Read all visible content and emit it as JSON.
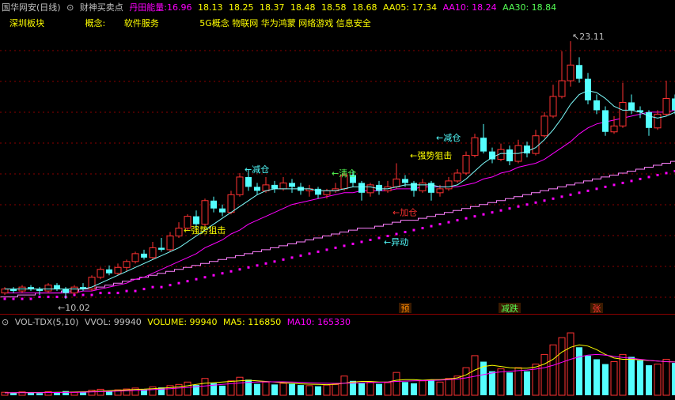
{
  "header": {
    "title": "国华网安(日线)",
    "indicator_name": "财神买卖点",
    "energy_label": "丹田能量:",
    "energy_value": "16.96",
    "levels": [
      "18.13",
      "18.25",
      "18.37",
      "18.48",
      "18.58",
      "18.68"
    ],
    "aa05": "AA05: 17.34",
    "aa10": "AA10: 18.24",
    "aa30": "AA30: 18.84",
    "board": "深圳板块",
    "concept_label": "概念:",
    "concept_1": "软件服务",
    "concept_2": "5G概念 物联网 华为鸿蒙 网络游戏 信息安全"
  },
  "volume_header": {
    "name": "VOL-TDX(5,10)",
    "vvol": "VVOL: 99940",
    "volume": "VOLUME: 99940",
    "ma5": "MA5: 116850",
    "ma10": "MA10: 165330"
  },
  "colors": {
    "up": "#ff3232",
    "down": "#54ffff",
    "ma_white": "#ffffff",
    "ma_magenta": "#ff00ff",
    "ma_yellow": "#ffff00",
    "dots": "#ff00ff",
    "grid": "#8b0000"
  },
  "chart_data": {
    "type": "candlestick",
    "price_range": [
      9.6,
      23.6
    ],
    "high_label": "23.11",
    "low_label": "10.02",
    "candles": [
      [
        10.3,
        10.5,
        10.6,
        10.2
      ],
      [
        10.5,
        10.4,
        10.6,
        10.3
      ],
      [
        10.4,
        10.6,
        10.7,
        10.3
      ],
      [
        10.6,
        10.5,
        10.7,
        10.4
      ],
      [
        10.5,
        10.4,
        10.6,
        10.2
      ],
      [
        10.4,
        10.7,
        10.8,
        10.3
      ],
      [
        10.7,
        10.5,
        10.8,
        10.4
      ],
      [
        10.5,
        10.3,
        10.6,
        10.0
      ],
      [
        10.3,
        10.6,
        10.7,
        10.2
      ],
      [
        10.6,
        10.5,
        10.8,
        10.4
      ],
      [
        10.5,
        11.1,
        11.2,
        10.4
      ],
      [
        11.1,
        11.5,
        11.6,
        11.0
      ],
      [
        11.5,
        11.3,
        11.7,
        11.2
      ],
      [
        11.3,
        11.6,
        11.8,
        11.2
      ],
      [
        11.6,
        11.9,
        12.0,
        11.4
      ],
      [
        11.9,
        12.3,
        12.4,
        11.8
      ],
      [
        12.3,
        12.1,
        12.5,
        12.0
      ],
      [
        12.1,
        12.6,
        12.9,
        12.0
      ],
      [
        12.6,
        12.5,
        13.1,
        12.4
      ],
      [
        12.5,
        13.2,
        13.4,
        12.4
      ],
      [
        13.2,
        13.6,
        13.9,
        13.1
      ],
      [
        13.6,
        14.2,
        14.3,
        13.5
      ],
      [
        14.2,
        13.8,
        14.5,
        13.6
      ],
      [
        13.8,
        15.0,
        15.1,
        13.7
      ],
      [
        15.0,
        14.6,
        15.2,
        14.4
      ],
      [
        14.6,
        14.4,
        14.8,
        14.2
      ],
      [
        14.4,
        15.3,
        15.5,
        14.3
      ],
      [
        15.3,
        16.2,
        16.4,
        15.2
      ],
      [
        16.2,
        15.7,
        16.6,
        15.5
      ],
      [
        15.7,
        15.5,
        15.9,
        15.3
      ],
      [
        15.5,
        15.8,
        16.2,
        15.4
      ],
      [
        15.8,
        15.6,
        16.0,
        15.4
      ],
      [
        15.6,
        15.9,
        16.2,
        15.5
      ],
      [
        15.9,
        15.7,
        16.1,
        15.4
      ],
      [
        15.7,
        15.5,
        15.9,
        15.3
      ],
      [
        15.5,
        15.6,
        15.8,
        15.2
      ],
      [
        15.6,
        15.3,
        15.7,
        15.1
      ],
      [
        15.3,
        15.5,
        15.6,
        15.1
      ],
      [
        15.5,
        15.6,
        15.9,
        15.4
      ],
      [
        15.6,
        16.3,
        16.5,
        15.5
      ],
      [
        16.3,
        15.9,
        16.5,
        15.7
      ],
      [
        15.9,
        15.4,
        16.0,
        15.0
      ],
      [
        15.4,
        15.8,
        15.9,
        15.2
      ],
      [
        15.8,
        15.5,
        16.0,
        15.3
      ],
      [
        15.5,
        15.7,
        16.0,
        15.4
      ],
      [
        15.7,
        16.1,
        16.9,
        15.6
      ],
      [
        16.1,
        15.9,
        16.3,
        15.7
      ],
      [
        15.9,
        15.5,
        16.0,
        15.2
      ],
      [
        15.5,
        15.9,
        16.1,
        15.4
      ],
      [
        15.9,
        15.4,
        16.0,
        15.0
      ],
      [
        15.4,
        15.6,
        15.8,
        15.2
      ],
      [
        15.6,
        16.0,
        16.2,
        15.5
      ],
      [
        16.0,
        16.4,
        16.6,
        15.9
      ],
      [
        16.4,
        17.3,
        17.5,
        16.3
      ],
      [
        17.3,
        18.2,
        18.4,
        17.2
      ],
      [
        18.2,
        17.5,
        18.9,
        17.4
      ],
      [
        17.5,
        17.1,
        17.7,
        16.9
      ],
      [
        17.1,
        17.6,
        17.9,
        17.0
      ],
      [
        17.6,
        17.0,
        17.8,
        16.8
      ],
      [
        17.0,
        17.8,
        18.1,
        16.9
      ],
      [
        17.8,
        17.4,
        18.0,
        17.2
      ],
      [
        17.4,
        18.3,
        18.6,
        17.3
      ],
      [
        18.3,
        19.3,
        19.5,
        18.2
      ],
      [
        19.3,
        20.3,
        20.9,
        19.2
      ],
      [
        20.3,
        21.1,
        22.6,
        20.2
      ],
      [
        21.1,
        21.9,
        23.11,
        20.8
      ],
      [
        21.9,
        21.2,
        22.3,
        21.0
      ],
      [
        21.2,
        20.1,
        21.5,
        19.9
      ],
      [
        20.1,
        19.6,
        20.4,
        19.4
      ],
      [
        19.6,
        18.5,
        19.8,
        18.3
      ],
      [
        18.5,
        18.8,
        19.3,
        18.4
      ],
      [
        18.8,
        20.0,
        21.0,
        18.7
      ],
      [
        20.0,
        19.6,
        20.4,
        19.4
      ],
      [
        19.6,
        19.5,
        19.8,
        19.2
      ],
      [
        19.5,
        18.7,
        19.6,
        18.3
      ],
      [
        18.7,
        19.4,
        19.6,
        18.6
      ],
      [
        19.4,
        20.2,
        21.1,
        19.3
      ],
      [
        20.2,
        19.6,
        20.4,
        19.4
      ],
      [
        19.6,
        20.7,
        21.4,
        19.5
      ]
    ],
    "ma_white": [
      10.5,
      10.5,
      10.5,
      10.5,
      10.5,
      10.5,
      10.5,
      10.5,
      10.5,
      10.5,
      10.6,
      10.8,
      11.0,
      11.2,
      11.4,
      11.6,
      11.8,
      12.0,
      12.2,
      12.4,
      12.6,
      12.9,
      13.2,
      13.5,
      13.8,
      14.1,
      14.4,
      14.7,
      15.0,
      15.3,
      15.5,
      15.6,
      15.6,
      15.6,
      15.6,
      15.6,
      15.5,
      15.5,
      15.5,
      15.6,
      15.7,
      15.7,
      15.7,
      15.6,
      15.6,
      15.7,
      15.8,
      15.8,
      15.8,
      15.8,
      15.7,
      15.7,
      15.8,
      16.1,
      16.5,
      16.9,
      17.2,
      17.4,
      17.4,
      17.4,
      17.5,
      17.7,
      18.1,
      18.6,
      19.2,
      19.9,
      20.4,
      20.6,
      20.5,
      20.2,
      19.8,
      19.6,
      19.6,
      19.5,
      19.3,
      19.2,
      19.3,
      19.5,
      19.7
    ],
    "ma_magenta": [
      10.3,
      10.3,
      10.3,
      10.3,
      10.3,
      10.3,
      10.3,
      10.3,
      10.3,
      10.4,
      10.4,
      10.5,
      10.6,
      10.7,
      10.8,
      11.0,
      11.1,
      11.3,
      11.5,
      11.7,
      11.9,
      12.1,
      12.3,
      12.6,
      12.8,
      13.0,
      13.3,
      13.5,
      13.8,
      14.0,
      14.2,
      14.4,
      14.6,
      14.8,
      14.9,
      15.0,
      15.1,
      15.2,
      15.3,
      15.4,
      15.4,
      15.5,
      15.5,
      15.5,
      15.5,
      15.6,
      15.6,
      15.6,
      15.7,
      15.7,
      15.7,
      15.7,
      15.7,
      15.8,
      15.9,
      16.1,
      16.2,
      16.4,
      16.5,
      16.7,
      16.8,
      16.9,
      17.1,
      17.4,
      17.7,
      18.0,
      18.4,
      18.7,
      18.9,
      19.0,
      19.1,
      19.2,
      19.3,
      19.4,
      19.5,
      19.5,
      19.5,
      19.6,
      19.6
    ],
    "ma_slow": [
      10.1,
      10.1,
      10.2,
      10.2,
      10.3,
      10.3,
      10.3,
      10.4,
      10.4,
      10.5,
      10.5,
      10.6,
      10.7,
      10.8,
      10.9,
      11.0,
      11.1,
      11.2,
      11.3,
      11.4,
      11.5,
      11.6,
      11.7,
      11.8,
      11.9,
      12.0,
      12.1,
      12.2,
      12.3,
      12.4,
      12.5,
      12.6,
      12.7,
      12.8,
      12.9,
      13.0,
      13.1,
      13.2,
      13.3,
      13.4,
      13.5,
      13.6,
      13.6,
      13.7,
      13.8,
      13.9,
      14.0,
      14.0,
      14.1,
      14.2,
      14.3,
      14.4,
      14.5,
      14.6,
      14.7,
      14.8,
      14.9,
      15.0,
      15.1,
      15.2,
      15.3,
      15.4,
      15.5,
      15.6,
      15.7,
      15.8,
      15.9,
      16.0,
      16.1,
      16.2,
      16.3,
      16.4,
      16.5,
      16.6,
      16.7,
      16.8,
      16.9,
      17.0,
      17.2
    ],
    "dots": [
      10.0,
      10.0,
      10.0,
      10.0,
      10.1,
      10.1,
      10.1,
      10.1,
      10.2,
      10.2,
      10.2,
      10.3,
      10.3,
      10.3,
      10.4,
      10.4,
      10.5,
      10.6,
      10.6,
      10.7,
      10.8,
      10.9,
      11.0,
      11.1,
      11.2,
      11.3,
      11.4,
      11.5,
      11.6,
      11.7,
      11.8,
      11.9,
      12.0,
      12.1,
      12.2,
      12.3,
      12.4,
      12.5,
      12.6,
      12.7,
      12.8,
      12.9,
      13.0,
      13.1,
      13.2,
      13.3,
      13.4,
      13.5,
      13.6,
      13.7,
      13.8,
      13.9,
      14.0,
      14.1,
      14.2,
      14.3,
      14.4,
      14.5,
      14.6,
      14.7,
      14.8,
      14.9,
      15.0,
      15.1,
      15.2,
      15.3,
      15.4,
      15.5,
      15.6,
      15.7,
      15.8,
      15.9,
      16.0,
      16.1,
      16.2,
      16.3,
      16.4,
      16.5,
      16.6
    ],
    "signals": [
      {
        "text": "←强势狙击",
        "index": 20,
        "price": 13.5,
        "color": "#ffff00"
      },
      {
        "text": "←减仓",
        "index": 27,
        "price": 16.6,
        "color": "#54ffff"
      },
      {
        "text": "←清仓",
        "index": 37,
        "price": 16.4,
        "color": "#54ff54"
      },
      {
        "text": "←强势狙击",
        "index": 46,
        "price": 17.3,
        "color": "#ffff00"
      },
      {
        "text": "←减仓",
        "index": 49,
        "price": 18.2,
        "color": "#54ffff"
      },
      {
        "text": "←加仓",
        "index": 44,
        "price": 14.4,
        "color": "#ff3232"
      },
      {
        "text": "←异动",
        "index": 43,
        "price": 12.9,
        "color": "#54ffff"
      }
    ],
    "markers": [
      {
        "text": "预",
        "index": 46,
        "color": "#ff8c00"
      },
      {
        "text": "减跌",
        "index": 58,
        "color": "#54ff54"
      },
      {
        "text": "张",
        "index": 68,
        "color": "#ff3232"
      }
    ],
    "volume_range": [
      0,
      560000
    ],
    "volumes": [
      25000,
      20000,
      28000,
      22000,
      18000,
      30000,
      26000,
      35000,
      24000,
      30000,
      42000,
      50000,
      38000,
      45000,
      52000,
      60000,
      48000,
      70000,
      65000,
      80000,
      90000,
      110000,
      85000,
      140000,
      100000,
      80000,
      120000,
      150000,
      130000,
      95000,
      110000,
      90000,
      100000,
      95000,
      85000,
      80000,
      75000,
      85000,
      90000,
      160000,
      120000,
      100000,
      110000,
      95000,
      105000,
      190000,
      110000,
      100000,
      120000,
      130000,
      110000,
      140000,
      160000,
      230000,
      330000,
      280000,
      200000,
      220000,
      190000,
      230000,
      200000,
      260000,
      340000,
      420000,
      480000,
      520000,
      400000,
      330000,
      300000,
      260000,
      280000,
      340000,
      320000,
      290000,
      250000,
      260000,
      300000,
      270000,
      310000
    ],
    "vol_ma5": [
      22000,
      22000,
      23000,
      23000,
      23000,
      24000,
      25000,
      26000,
      27000,
      29000,
      31000,
      35000,
      38000,
      42000,
      45000,
      49000,
      51000,
      55000,
      59000,
      63000,
      70000,
      79000,
      90000,
      100000,
      105000,
      110000,
      115000,
      120000,
      125000,
      120000,
      115000,
      110000,
      105000,
      100000,
      95000,
      92000,
      90000,
      88000,
      92000,
      100000,
      110000,
      115000,
      115000,
      110000,
      110000,
      125000,
      130000,
      130000,
      125000,
      130000,
      130000,
      135000,
      145000,
      170000,
      210000,
      240000,
      250000,
      240000,
      230000,
      225000,
      225000,
      235000,
      260000,
      300000,
      360000,
      400000,
      420000,
      410000,
      380000,
      340000,
      310000,
      300000,
      300000,
      295000,
      290000,
      285000,
      280000,
      278000,
      280000
    ],
    "vol_ma10": [
      20000,
      21000,
      21000,
      22000,
      22000,
      23000,
      23000,
      24000,
      25000,
      26000,
      28000,
      30000,
      32000,
      34000,
      37000,
      40000,
      43000,
      47000,
      51000,
      55000,
      60000,
      65000,
      72000,
      78000,
      84000,
      90000,
      96000,
      102000,
      108000,
      110000,
      112000,
      112000,
      112000,
      110000,
      108000,
      105000,
      102000,
      100000,
      99000,
      100000,
      102000,
      104000,
      106000,
      108000,
      110000,
      115000,
      118000,
      120000,
      122000,
      124000,
      126000,
      130000,
      135000,
      145000,
      158000,
      172000,
      185000,
      195000,
      200000,
      205000,
      210000,
      218000,
      230000,
      250000,
      275000,
      300000,
      320000,
      335000,
      340000,
      335000,
      325000,
      315000,
      308000,
      300000,
      292000,
      285000,
      280000,
      277000,
      275000
    ]
  }
}
